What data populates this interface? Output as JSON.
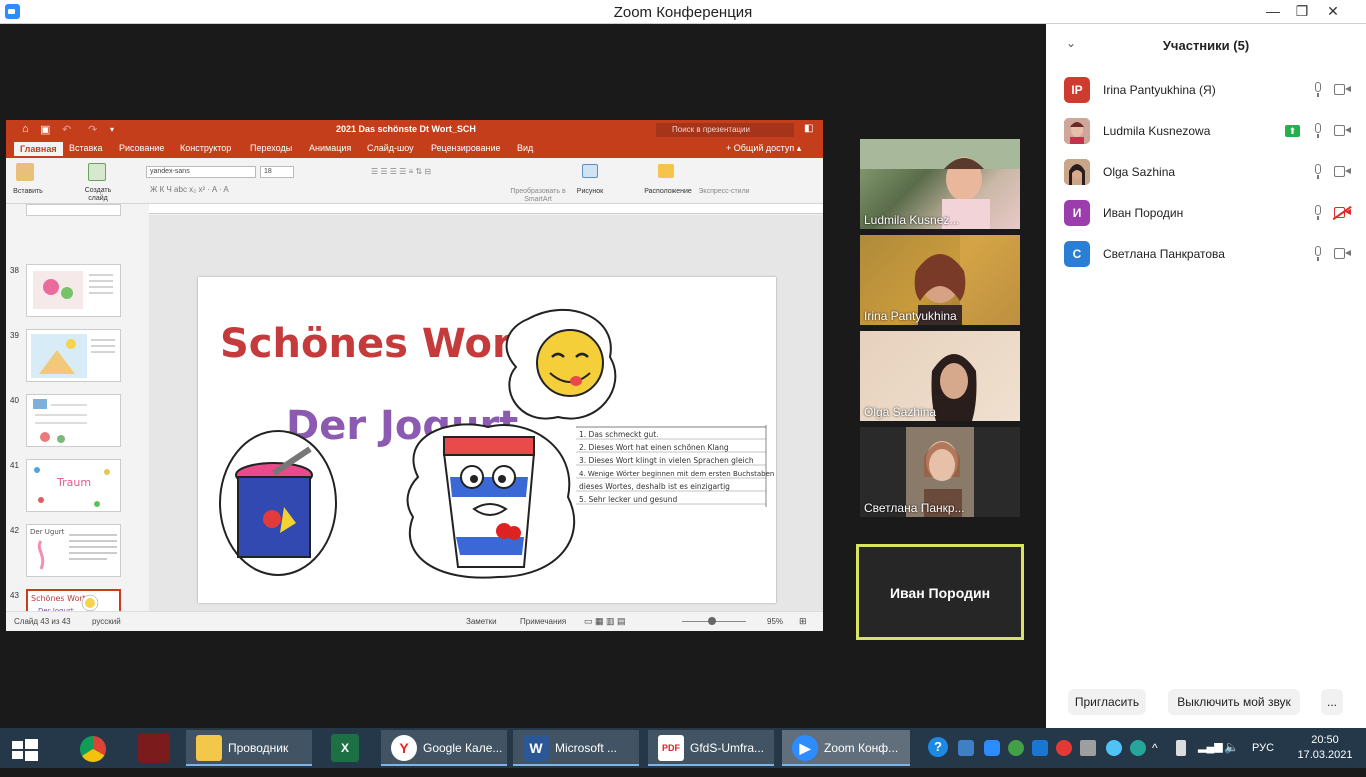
{
  "window": {
    "title": "Zoom Конференция"
  },
  "ppt": {
    "doc_title": "2021 Das schönste Dt Wort_SCH",
    "search_placeholder": "Поиск в презентации",
    "tabs": [
      "Главная",
      "Вставка",
      "Рисование",
      "Конструктор",
      "Переходы",
      "Анимация",
      "Слайд-шоу",
      "Рецензирование",
      "Вид"
    ],
    "share_label": "Общий доступ",
    "ribbon": {
      "paste": "Вставить",
      "new_slide": "Создать слайд",
      "font": "yandex-sans",
      "font_size": "18",
      "smartart": "Преобразовать в SmartArt",
      "picture": "Рисунок",
      "arrange": "Расположение",
      "quick_styles": "Экспресс-стили"
    },
    "thumbnails": [
      "38",
      "39",
      "40",
      "41",
      "42",
      "43"
    ],
    "status": {
      "slide": "Слайд 43 из 43",
      "lang": "русский",
      "notes": "Заметки",
      "comments": "Примечания",
      "zoom": "95%"
    },
    "slide": {
      "heading1": "Schönes Wort:",
      "heading2": "Der Jogurt",
      "list": [
        "1. Das schmeckt gut.",
        "2. Dieses Wort hat einen schönen Klang",
        "3. Dieses Wort klingt in vielen Sprachen gleich",
        "4. Wenige Wörter beginnen mit dem ersten Buchstaben",
        "dieses Wortes, deshalb ist es einzigartig",
        "5. Sehr lecker und gesund"
      ],
      "thumb42_title": "Der Ugurt",
      "thumb41_title": "Traum"
    }
  },
  "tiles": [
    {
      "name": "Ludmila Kusnez..."
    },
    {
      "name": "Irina Pantyukhina"
    },
    {
      "name": "Olga Sazhina"
    },
    {
      "name": "Светлана Панкр..."
    }
  ],
  "active_tile": {
    "name": "Иван Породин"
  },
  "panel": {
    "title": "Участники (5)",
    "participants": [
      {
        "initials": "IP",
        "name": "Irina Pantyukhina (Я)",
        "color": "#cf3b2e"
      },
      {
        "initials": "",
        "name": "Ludmila Kusnezowa",
        "color": "#b04f4f"
      },
      {
        "initials": "",
        "name": "Olga Sazhina",
        "color": "#8a5a4a"
      },
      {
        "initials": "И",
        "name": "Иван Породин",
        "color": "#9c3dad"
      },
      {
        "initials": "С",
        "name": "Светлана Панкратова",
        "color": "#2a7ed3"
      }
    ],
    "invite": "Пригласить",
    "mute_me": "Выключить мой звук",
    "more": "..."
  },
  "taskbar": {
    "apps": [
      {
        "label": "Проводник",
        "icon": "folder-icon"
      },
      {
        "label": "Google Кале...",
        "icon": "yandex-browser-icon"
      },
      {
        "label": "Microsoft ...",
        "icon": "word-icon"
      },
      {
        "label": "GfdS-Umfra...",
        "icon": "pdf-icon"
      },
      {
        "label": "Zoom Конф...",
        "icon": "zoom-icon"
      }
    ],
    "lang": "РУС",
    "time": "20:50",
    "date": "17.03.2021"
  }
}
